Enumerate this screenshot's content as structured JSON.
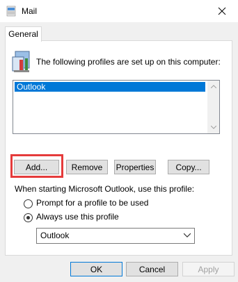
{
  "window": {
    "title": "Mail"
  },
  "tabs": [
    {
      "label": "General"
    }
  ],
  "profiles": {
    "label": "The following profiles are set up on this computer:",
    "items": [
      {
        "label": "Outlook",
        "selected": true
      }
    ]
  },
  "buttons": {
    "add": "Add...",
    "remove": "Remove",
    "properties": "Properties",
    "copy": "Copy..."
  },
  "startup": {
    "label": "When starting Microsoft Outlook, use this profile:",
    "options": [
      {
        "label": "Prompt for a profile to be used",
        "checked": false
      },
      {
        "label": "Always use this profile",
        "checked": true
      }
    ],
    "selected_profile": "Outlook"
  },
  "footer": {
    "ok": "OK",
    "cancel": "Cancel",
    "apply": "Apply"
  },
  "colors": {
    "accent": "#0078d7",
    "highlight": "#e53b3b"
  }
}
